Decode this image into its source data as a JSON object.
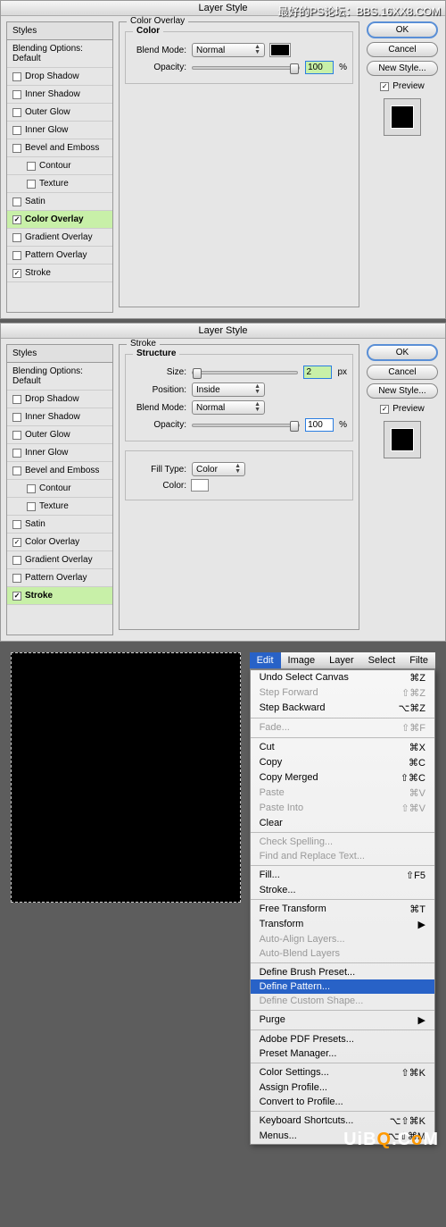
{
  "watermark": "最好的PS论坛：BBS.16XX8.COM",
  "dialog1": {
    "title": "Layer Style",
    "stylesHeader": "Styles",
    "blending": "Blending Options: Default",
    "items": [
      {
        "label": "Drop Shadow",
        "checked": false,
        "sub": false
      },
      {
        "label": "Inner Shadow",
        "checked": false,
        "sub": false
      },
      {
        "label": "Outer Glow",
        "checked": false,
        "sub": false
      },
      {
        "label": "Inner Glow",
        "checked": false,
        "sub": false
      },
      {
        "label": "Bevel and Emboss",
        "checked": false,
        "sub": false
      },
      {
        "label": "Contour",
        "checked": false,
        "sub": true
      },
      {
        "label": "Texture",
        "checked": false,
        "sub": true
      },
      {
        "label": "Satin",
        "checked": false,
        "sub": false
      },
      {
        "label": "Color Overlay",
        "checked": true,
        "sub": false,
        "selected": true
      },
      {
        "label": "Gradient Overlay",
        "checked": false,
        "sub": false
      },
      {
        "label": "Pattern Overlay",
        "checked": false,
        "sub": false
      },
      {
        "label": "Stroke",
        "checked": true,
        "sub": false
      }
    ],
    "centerTitle": "Color Overlay",
    "innerTitle": "Color",
    "blendModeLbl": "Blend Mode:",
    "blendModeVal": "Normal",
    "opacityLbl": "Opacity:",
    "opacityVal": "100",
    "opacityUnit": "%",
    "ok": "OK",
    "cancel": "Cancel",
    "newStyle": "New Style...",
    "preview": "Preview"
  },
  "dialog2": {
    "title": "Layer Style",
    "stylesHeader": "Styles",
    "blending": "Blending Options: Default",
    "items": [
      {
        "label": "Drop Shadow",
        "checked": false,
        "sub": false
      },
      {
        "label": "Inner Shadow",
        "checked": false,
        "sub": false
      },
      {
        "label": "Outer Glow",
        "checked": false,
        "sub": false
      },
      {
        "label": "Inner Glow",
        "checked": false,
        "sub": false
      },
      {
        "label": "Bevel and Emboss",
        "checked": false,
        "sub": false
      },
      {
        "label": "Contour",
        "checked": false,
        "sub": true
      },
      {
        "label": "Texture",
        "checked": false,
        "sub": true
      },
      {
        "label": "Satin",
        "checked": false,
        "sub": false
      },
      {
        "label": "Color Overlay",
        "checked": true,
        "sub": false
      },
      {
        "label": "Gradient Overlay",
        "checked": false,
        "sub": false
      },
      {
        "label": "Pattern Overlay",
        "checked": false,
        "sub": false
      },
      {
        "label": "Stroke",
        "checked": true,
        "sub": false,
        "selected": true
      }
    ],
    "centerTitle": "Stroke",
    "structTitle": "Structure",
    "sizeLbl": "Size:",
    "sizeVal": "2",
    "sizeUnit": "px",
    "posLbl": "Position:",
    "posVal": "Inside",
    "blendModeLbl": "Blend Mode:",
    "blendModeVal": "Normal",
    "opacityLbl": "Opacity:",
    "opacityVal": "100",
    "opacityUnit": "%",
    "fillTypeLbl": "Fill Type:",
    "fillTypeVal": "Color",
    "colorLbl": "Color:",
    "ok": "OK",
    "cancel": "Cancel",
    "newStyle": "New Style...",
    "preview": "Preview"
  },
  "menubar": {
    "items": [
      "Edit",
      "Image",
      "Layer",
      "Select",
      "Filte"
    ]
  },
  "editMenu": [
    {
      "label": "Undo Select Canvas",
      "sc": "⌘Z"
    },
    {
      "label": "Step Forward",
      "sc": "⇧⌘Z",
      "disabled": true
    },
    {
      "label": "Step Backward",
      "sc": "⌥⌘Z"
    },
    {
      "sep": true
    },
    {
      "label": "Fade...",
      "sc": "⇧⌘F",
      "disabled": true
    },
    {
      "sep": true
    },
    {
      "label": "Cut",
      "sc": "⌘X"
    },
    {
      "label": "Copy",
      "sc": "⌘C"
    },
    {
      "label": "Copy Merged",
      "sc": "⇧⌘C"
    },
    {
      "label": "Paste",
      "sc": "⌘V",
      "disabled": true
    },
    {
      "label": "Paste Into",
      "sc": "⇧⌘V",
      "disabled": true
    },
    {
      "label": "Clear",
      "sc": ""
    },
    {
      "sep": true
    },
    {
      "label": "Check Spelling...",
      "disabled": true
    },
    {
      "label": "Find and Replace Text...",
      "disabled": true
    },
    {
      "sep": true
    },
    {
      "label": "Fill...",
      "sc": "⇧F5"
    },
    {
      "label": "Stroke...",
      "sc": ""
    },
    {
      "sep": true
    },
    {
      "label": "Free Transform",
      "sc": "⌘T"
    },
    {
      "label": "Transform",
      "sc": "▶"
    },
    {
      "label": "Auto-Align Layers...",
      "disabled": true
    },
    {
      "label": "Auto-Blend Layers",
      "disabled": true
    },
    {
      "sep": true
    },
    {
      "label": "Define Brush Preset...",
      "sc": ""
    },
    {
      "label": "Define Pattern...",
      "sc": "",
      "sel": true
    },
    {
      "label": "Define Custom Shape...",
      "disabled": true
    },
    {
      "sep": true
    },
    {
      "label": "Purge",
      "sc": "▶"
    },
    {
      "sep": true
    },
    {
      "label": "Adobe PDF Presets...",
      "sc": ""
    },
    {
      "label": "Preset Manager...",
      "sc": ""
    },
    {
      "sep": true
    },
    {
      "label": "Color Settings...",
      "sc": "⇧⌘K"
    },
    {
      "label": "Assign Profile...",
      "sc": ""
    },
    {
      "label": "Convert to Profile...",
      "sc": ""
    },
    {
      "sep": true
    },
    {
      "label": "Keyboard Shortcuts...",
      "sc": "⌥⇧⌘K"
    },
    {
      "label": "Menus...",
      "sc": "⌥⇧⌘M"
    }
  ],
  "logo": {
    "pre": "UiB",
    "mid": "Q",
    "post": ".C",
    "end": "M"
  }
}
